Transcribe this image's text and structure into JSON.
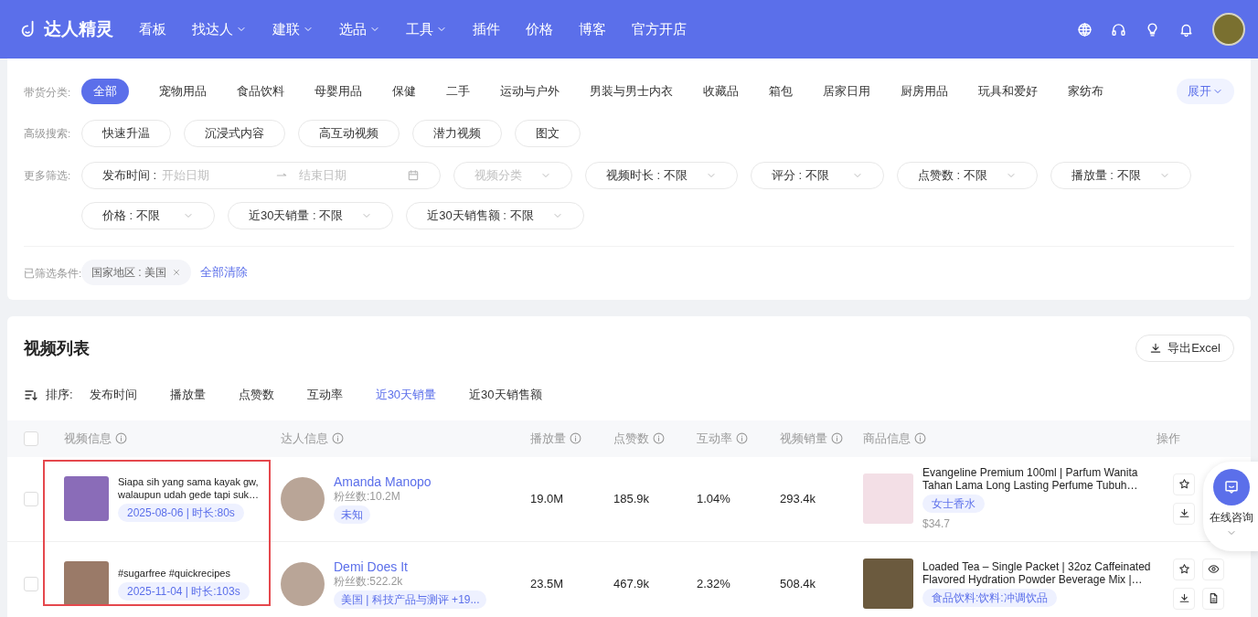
{
  "header": {
    "logo": "达人精灵",
    "nav": [
      {
        "label": "看板",
        "dropdown": false
      },
      {
        "label": "找达人",
        "dropdown": true
      },
      {
        "label": "建联",
        "dropdown": true
      },
      {
        "label": "选品",
        "dropdown": true
      },
      {
        "label": "工具",
        "dropdown": true
      },
      {
        "label": "插件",
        "dropdown": false
      },
      {
        "label": "价格",
        "dropdown": false
      },
      {
        "label": "博客",
        "dropdown": false
      },
      {
        "label": "官方开店",
        "dropdown": false
      }
    ]
  },
  "filters": {
    "categories": {
      "label": "带货分类:",
      "items": [
        {
          "label": "全部",
          "selected": true
        },
        {
          "label": "宠物用品",
          "selected": false
        },
        {
          "label": "食品饮料",
          "selected": false
        },
        {
          "label": "母婴用品",
          "selected": false
        },
        {
          "label": "保健",
          "selected": false
        },
        {
          "label": "二手",
          "selected": false
        },
        {
          "label": "运动与户外",
          "selected": false
        },
        {
          "label": "男装与男士内衣",
          "selected": false
        },
        {
          "label": "收藏品",
          "selected": false
        },
        {
          "label": "箱包",
          "selected": false
        },
        {
          "label": "居家日用",
          "selected": false
        },
        {
          "label": "厨房用品",
          "selected": false
        },
        {
          "label": "玩具和爱好",
          "selected": false
        },
        {
          "label": "家纺布",
          "selected": false
        }
      ],
      "expand": "展开"
    },
    "advanced": {
      "label": "高级搜索:",
      "items": [
        "快速升温",
        "沉浸式内容",
        "高互动视频",
        "潜力视频",
        "图文"
      ]
    },
    "more": {
      "label": "更多筛选:",
      "date_range": {
        "label": "发布时间 :",
        "start_placeholder": "开始日期",
        "end_placeholder": "结束日期"
      },
      "dropdowns": [
        {
          "label": "视频分类",
          "disabled": true
        },
        {
          "label": "视频时长 : 不限",
          "disabled": false
        },
        {
          "label": "评分 : 不限",
          "disabled": false
        },
        {
          "label": "点赞数 : 不限",
          "disabled": false
        },
        {
          "label": "播放量 : 不限",
          "disabled": false
        },
        {
          "label": "价格 : 不限",
          "disabled": false
        },
        {
          "label": "近30天销量 : 不限",
          "disabled": false
        },
        {
          "label": "近30天销售额 : 不限",
          "disabled": false
        }
      ]
    },
    "applied": {
      "label": "已筛选条件:",
      "tags": [
        "国家地区 : 美国"
      ],
      "clear": "全部清除"
    }
  },
  "video_list": {
    "title": "视频列表",
    "export": "导出Excel",
    "sort": {
      "label": "排序:",
      "options": [
        {
          "label": "发布时间",
          "selected": false
        },
        {
          "label": "播放量",
          "selected": false
        },
        {
          "label": "点赞数",
          "selected": false
        },
        {
          "label": "互动率",
          "selected": false
        },
        {
          "label": "近30天销量",
          "selected": true
        },
        {
          "label": "近30天销售额",
          "selected": false
        }
      ]
    },
    "table": {
      "all_checked": false,
      "columns": [
        {
          "label": "视频信息",
          "info": true
        },
        {
          "label": "达人信息",
          "info": true
        },
        {
          "label": "播放量",
          "info": true
        },
        {
          "label": "点赞数",
          "info": true
        },
        {
          "label": "互动率",
          "info": true
        },
        {
          "label": "视频销量",
          "info": true
        },
        {
          "label": "商品信息",
          "info": true
        },
        {
          "label": "操作",
          "info": false
        }
      ],
      "rows": [
        {
          "checked": false,
          "video": {
            "title": "Siapa sih yang sama kayak gw, walaupun udah gede tapi suk…",
            "meta": "2025-08-06 | 时长:80s"
          },
          "creator": {
            "name": "Amanda Manopo",
            "fans": "粉丝数:10.2M",
            "tag": "未知"
          },
          "plays": "19.0M",
          "likes": "185.9k",
          "rate": "1.04%",
          "sales": "293.4k",
          "product": {
            "title": "Evangeline Premium 100ml | Parfum Wanita Tahan Lama Long Lasting Perfume Tubuh…",
            "category": "女士香水",
            "price": "$34.7"
          }
        },
        {
          "checked": false,
          "video": {
            "title": "#sugarfree #quickrecipes",
            "meta": "2025-11-04 | 时长:103s"
          },
          "creator": {
            "name": "Demi Does It",
            "fans": "粉丝数:522.2k",
            "tag": "美国 | 科技产品与测评 +19..."
          },
          "plays": "23.5M",
          "likes": "467.9k",
          "rate": "2.32%",
          "sales": "508.4k",
          "product": {
            "title": "Loaded Tea – Single Packet | 32oz Caffeinated Flavored Hydration Powder Beverage Mix |…",
            "category": "食品饮料:饮料:冲调饮品"
          }
        }
      ]
    }
  },
  "consult": {
    "label": "在线咨询"
  }
}
